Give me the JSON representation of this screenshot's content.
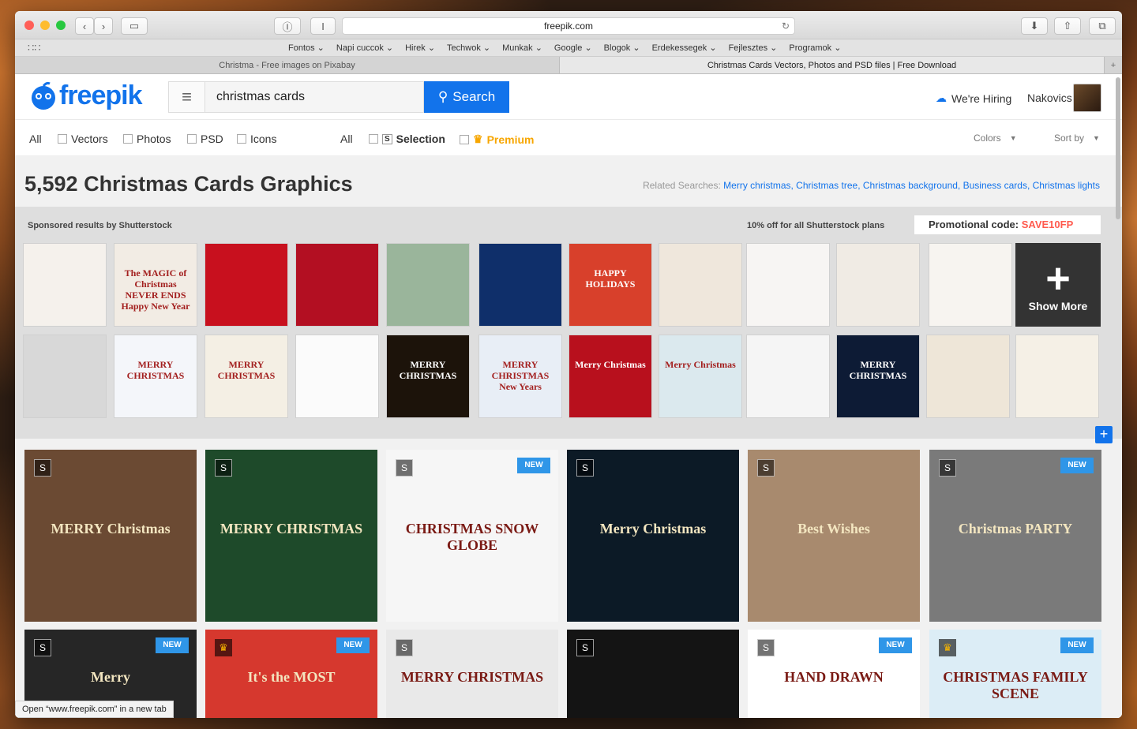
{
  "browser": {
    "url": "freepik.com",
    "bookmarks": [
      "Fontos",
      "Napi cuccok",
      "Hirek",
      "Techwok",
      "Munkak",
      "Google",
      "Blogok",
      "Erdekessegek",
      "Fejlesztes",
      "Programok"
    ],
    "tabs": [
      {
        "label": "Christma - Free images on Pixabay",
        "active": false
      },
      {
        "label": "Christmas Cards Vectors, Photos and PSD files | Free Download",
        "active": true
      }
    ],
    "status": "Open “www.freepik.com” in a new tab",
    "colors": {
      "close": "#ff5f57",
      "minimize": "#febc2e",
      "zoom": "#28c840"
    }
  },
  "header": {
    "logo_text": "freepik",
    "search_value": "christmas cards",
    "search_button": "Search",
    "hiring": "We're Hiring",
    "username": "Nakovics",
    "accent": "#1273eb"
  },
  "filters": {
    "types": [
      "All",
      "Vectors",
      "Photos",
      "PSD",
      "Icons"
    ],
    "licence": [
      "All",
      "Selection",
      "Premium"
    ],
    "selection_badge": "S",
    "colors_label": "Colors",
    "sort_label": "Sort by"
  },
  "results": {
    "title": "5,592 Christmas Cards Graphics",
    "related_label": "Related Searches:",
    "related": [
      "Merry christmas",
      "Christmas tree",
      "Christmas background",
      "Business cards",
      "Christmas lights"
    ]
  },
  "sponsored": {
    "label": "Sponsored results by Shutterstock",
    "offer": "10% off for all Shutterstock plans",
    "promo_label": "Promotional code:",
    "promo_code": "SAVE10FP",
    "show_more": "Show More",
    "row1_colors": [
      "#f5f1ec",
      "#f2ece4",
      "#c8101e",
      "#b30f22",
      "#9ab59b",
      "#0f2f6a",
      "#d8402b",
      "#efe7dc",
      "#f7f5f3",
      "#f0ebe4",
      "#f7f4f0"
    ],
    "row2_colors": [
      "#d8d8d8",
      "#f4f6fa",
      "#f4efe4",
      "#fbfbfb",
      "#1c130a",
      "#e8eef6",
      "#b8101d",
      "#dbe9ee",
      "#f5f5f5",
      "#0d1b35",
      "#eee6d8",
      "#f5f0e6"
    ],
    "texts": {
      "r1_2": "The MAGIC of Christmas NEVER ENDS Happy New Year",
      "r1_7": "HAPPY HOLIDAYS",
      "r2_2": "MERRY CHRISTMAS",
      "r2_3": "MERRY CHRISTMAS",
      "r2_5": "MERRY CHRISTMAS",
      "r2_6": "MERRY CHRISTMAS New Years",
      "r2_7": "Merry Christmas",
      "r2_8": "Merry Christmas",
      "r2_10": "MERRY CHRISTMAS"
    }
  },
  "grid": {
    "new_label": "NEW",
    "badge_s": "S",
    "row1": [
      {
        "bg": "#6b4a33",
        "badge": "S",
        "isnew": false,
        "text": "MERRY Christmas"
      },
      {
        "bg": "#1e4a2a",
        "badge": "S",
        "isnew": false,
        "text": "MERRY CHRISTMAS"
      },
      {
        "bg": "#f6f6f6",
        "badge": "S",
        "isnew": true,
        "text": "CHRISTMAS SNOW GLOBE"
      },
      {
        "bg": "#0c1a26",
        "badge": "S",
        "isnew": false,
        "text": "Merry Christmas"
      },
      {
        "bg": "#a88a6e",
        "badge": "S",
        "isnew": false,
        "text": "Best Wishes"
      },
      {
        "bg": "#7a7a7a",
        "badge": "S",
        "isnew": true,
        "text": "Christmas PARTY"
      }
    ],
    "row2": [
      {
        "bg": "#262626",
        "badge": "S",
        "isnew": true,
        "text": "Merry"
      },
      {
        "bg": "#d6382e",
        "badge": "crown",
        "isnew": true,
        "text": "It's the MOST"
      },
      {
        "bg": "#e9e9e9",
        "badge": "S",
        "isnew": false,
        "text": "MERRY CHRISTMAS"
      },
      {
        "bg": "#141414",
        "badge": "S",
        "isnew": false,
        "text": ""
      },
      {
        "bg": "#ffffff",
        "badge": "S",
        "isnew": true,
        "text": "HAND DRAWN"
      },
      {
        "bg": "#dcedf6",
        "badge": "crown",
        "isnew": true,
        "text": "CHRISTMAS FAMILY SCENE"
      }
    ]
  }
}
